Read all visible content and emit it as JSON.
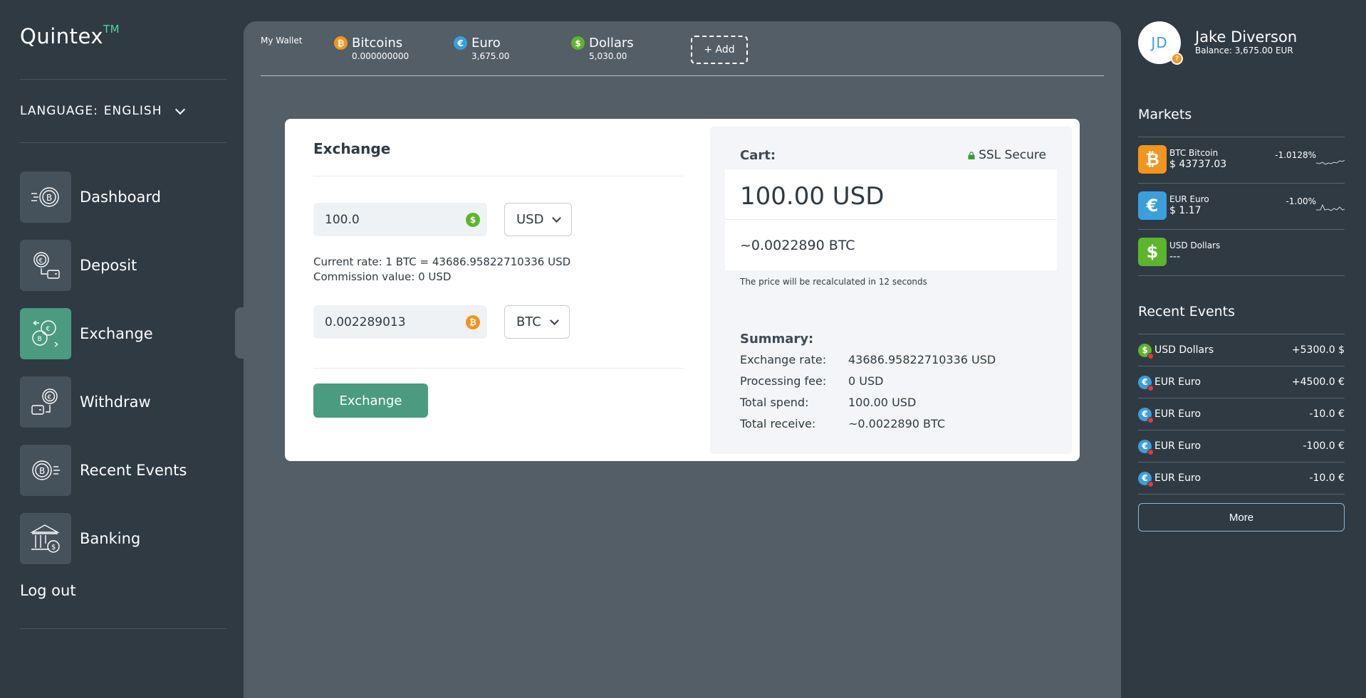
{
  "app": {
    "logo_text": "Quintex",
    "logo_tm": "TM"
  },
  "sidebar": {
    "language_label": "LANGUAGE:",
    "language_value": "ENGLISH",
    "items": [
      {
        "label": "Dashboard",
        "icon": "bitcoin-arrows-icon"
      },
      {
        "label": "Deposit",
        "icon": "coin-to-wallet-icon"
      },
      {
        "label": "Exchange",
        "icon": "coins-exchange-icon",
        "active": true
      },
      {
        "label": "Withdraw",
        "icon": "wallet-withdraw-icon"
      },
      {
        "label": "Recent Events",
        "icon": "bitcoin-list-icon"
      },
      {
        "label": "Banking",
        "icon": "bank-icon"
      }
    ],
    "logout_label": "Log out"
  },
  "wallet": {
    "label": "My Wallet",
    "accounts": [
      {
        "name": "Bitcoins",
        "amount": "0.000000000",
        "icon": "bitcoin-icon"
      },
      {
        "name": "Euro",
        "amount": "3,675.00",
        "icon": "euro-icon"
      },
      {
        "name": "Dollars",
        "amount": "5,030.00",
        "icon": "dollar-icon"
      }
    ],
    "add_label": "+ Add"
  },
  "exchange": {
    "title": "Exchange",
    "from_amount": "100.0",
    "from_currency": "USD",
    "rate_line": "Current rate: 1 BTC = 43686.95822710336 USD",
    "commission_line": "Commission value: 0 USD",
    "to_amount": "0.002289013",
    "to_currency": "BTC",
    "button_label": "Exchange"
  },
  "cart": {
    "label": "Cart:",
    "ssl_label": "SSL Secure",
    "main_amount": "100.00 USD",
    "sub_amount": "~0.0022890 BTC",
    "recalc_note": "The price will be recalculated in 12 seconds",
    "summary_title": "Summary:",
    "summary": [
      {
        "key": "Exchange rate:",
        "value": "43686.95822710336 USD"
      },
      {
        "key": "Processing fee:",
        "value": "0 USD"
      },
      {
        "key": "Total spend:",
        "value": "100.00 USD"
      },
      {
        "key": "Total receive:",
        "value": "~0.0022890 BTC"
      }
    ]
  },
  "user": {
    "initials": "JD",
    "name": "Jake Diverson",
    "balance": "Balance: 3,675.00 EUR"
  },
  "markets": {
    "title": "Markets",
    "items": [
      {
        "name": "BTC Bitcoin",
        "price": "$ 43737.03",
        "change": "-1.0128%",
        "color": "#f2951f",
        "icon": "bitcoin-icon"
      },
      {
        "name": "EUR Euro",
        "price": "$ 1.17",
        "change": "-1.00%",
        "color": "#3a9fdc",
        "icon": "euro-icon"
      },
      {
        "name": "USD Dollars",
        "price": "---",
        "change": "",
        "color": "#5db52c",
        "icon": "dollar-icon"
      }
    ]
  },
  "events": {
    "title": "Recent Events",
    "items": [
      {
        "name": "USD Dollars",
        "amount": "+5300.0 $",
        "icon": "dollar-icon"
      },
      {
        "name": "EUR Euro",
        "amount": "+4500.0 €",
        "icon": "euro-icon"
      },
      {
        "name": "EUR Euro",
        "amount": "-10.0 €",
        "icon": "euro-icon"
      },
      {
        "name": "EUR Euro",
        "amount": "-100.0 €",
        "icon": "euro-icon"
      },
      {
        "name": "EUR Euro",
        "amount": "-10.0 €",
        "icon": "euro-icon"
      }
    ],
    "more_label": "More"
  },
  "colors": {
    "accent": "#4a9b80",
    "bitcoin": "#f2951f",
    "euro": "#3a9fdc",
    "dollar": "#5db52c",
    "background": "#2f3a43",
    "panel": "#535e67"
  }
}
